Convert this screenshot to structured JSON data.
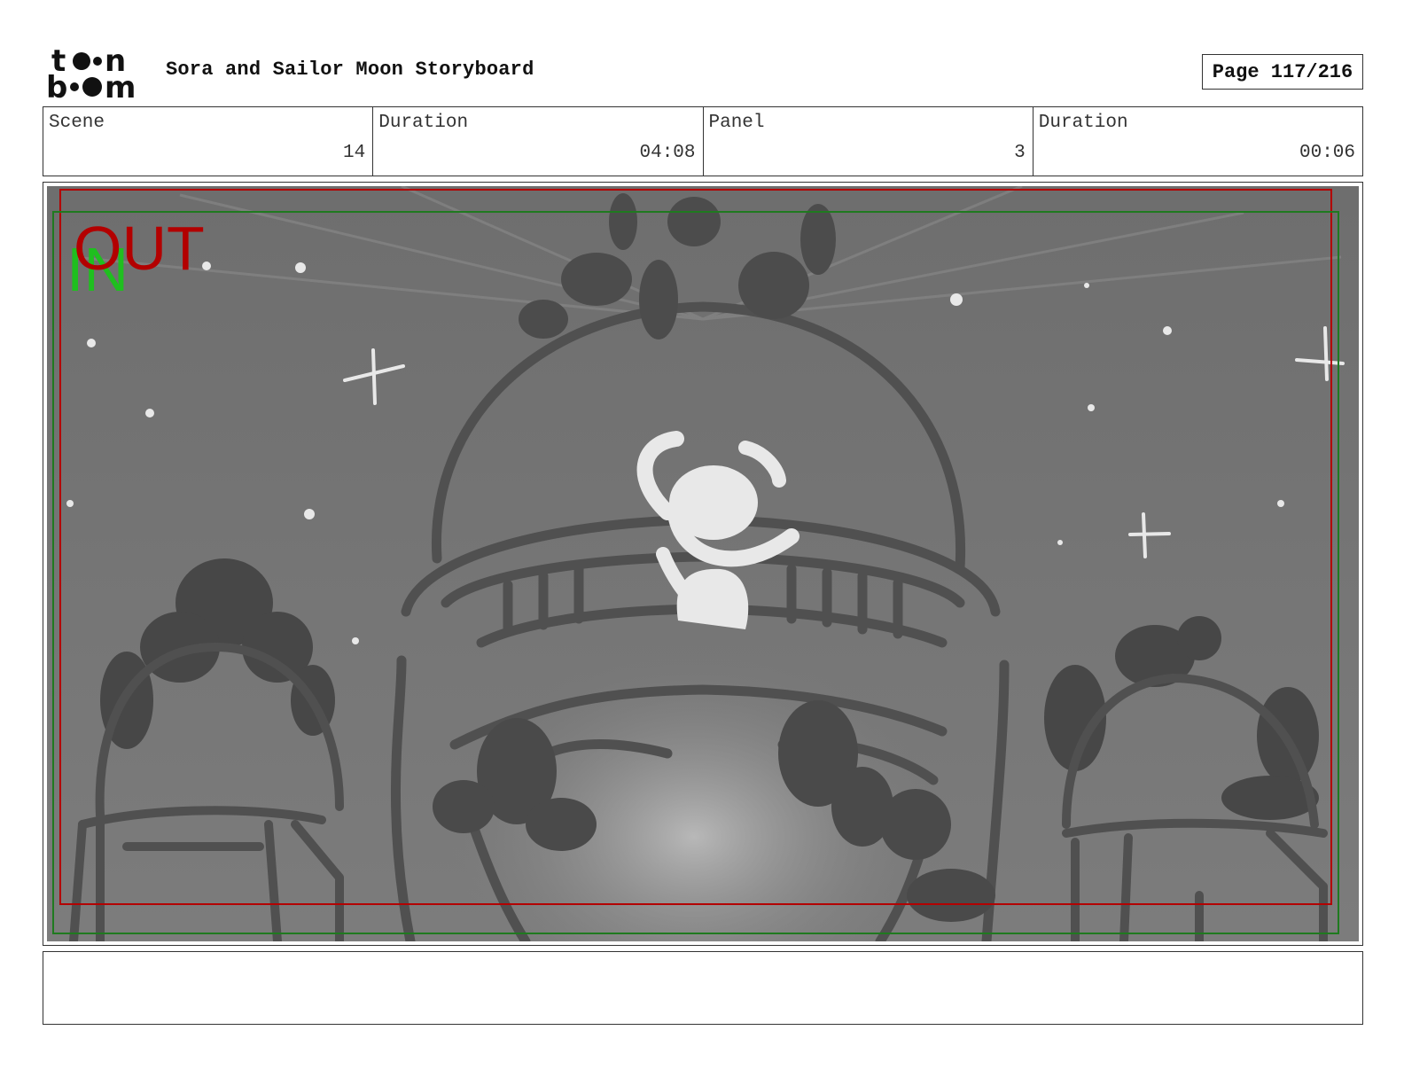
{
  "header": {
    "logo_text": "toon boom",
    "title": "Sora and Sailor Moon Storyboard",
    "page": "Page 117/216"
  },
  "info": {
    "scene_label": "Scene",
    "scene_value": "14",
    "scene_duration_label": "Duration",
    "scene_duration_value": "04:08",
    "panel_label": "Panel",
    "panel_value": "3",
    "panel_duration_label": "Duration",
    "panel_duration_value": "00:06"
  },
  "frame": {
    "out_label": "OUT",
    "in_label": "IN",
    "colors": {
      "out": "#b30000",
      "in": "#1fbf1f",
      "sketch_bg": "#7a7a7a",
      "silhouette": "#4a4a4a",
      "highlight": "#ececec"
    }
  },
  "notes": {
    "text": ""
  }
}
